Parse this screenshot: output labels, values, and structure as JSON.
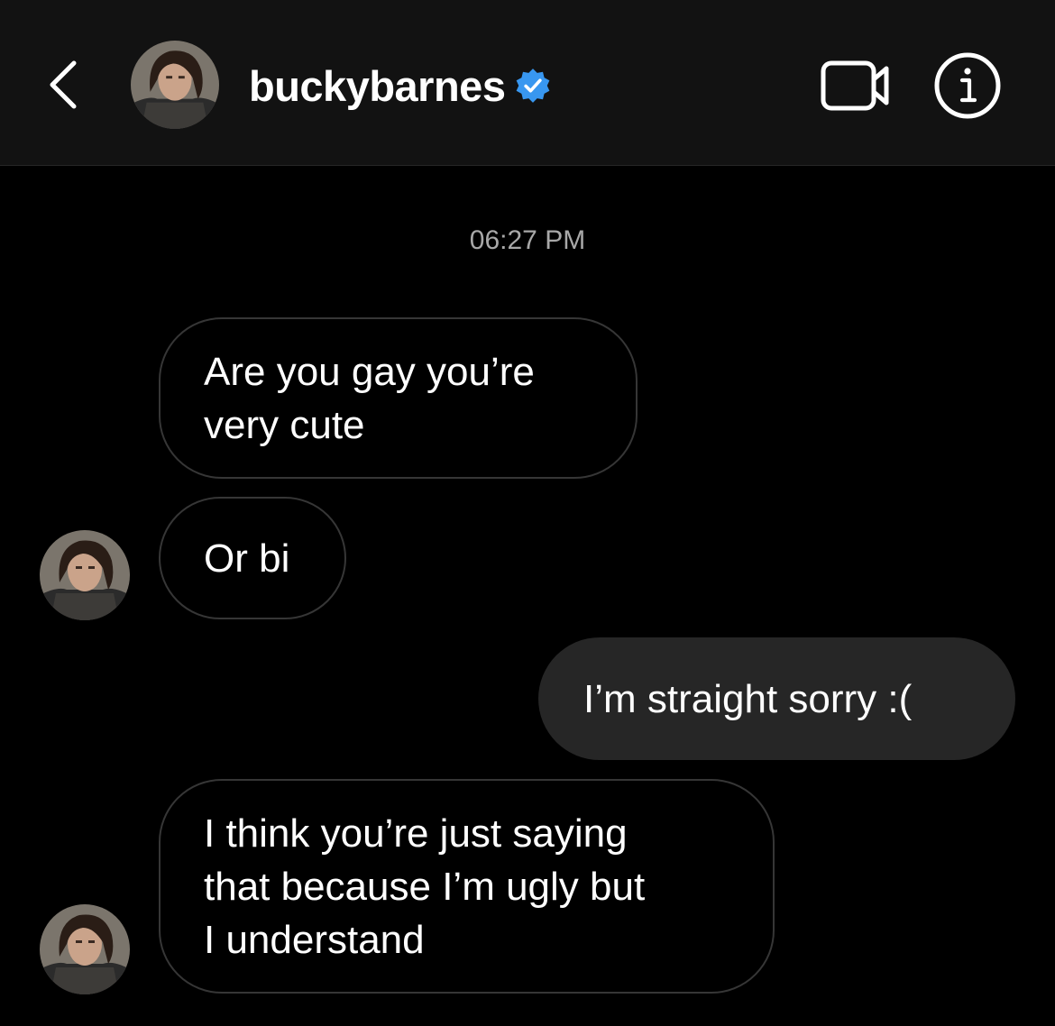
{
  "header": {
    "username": "buckybarnes",
    "verified": true,
    "icons": {
      "back": "chevron-left-icon",
      "video": "video-camera-icon",
      "info": "info-icon",
      "verified": "verified-badge-icon"
    },
    "colors": {
      "background": "#121212",
      "verified_badge": "#3897F0"
    }
  },
  "conversation": {
    "timestamp": "06:27 PM",
    "messages": [
      {
        "from": "buckybarnes",
        "direction": "received",
        "text": "Are you gay you’re\nvery cute"
      },
      {
        "from": "buckybarnes",
        "direction": "received",
        "text": "Or bi"
      },
      {
        "from": "me",
        "direction": "sent",
        "text": "I’m straight sorry :("
      },
      {
        "from": "buckybarnes",
        "direction": "received",
        "text": "I think you’re just saying\nthat because I’m ugly but\nI understand"
      }
    ]
  }
}
